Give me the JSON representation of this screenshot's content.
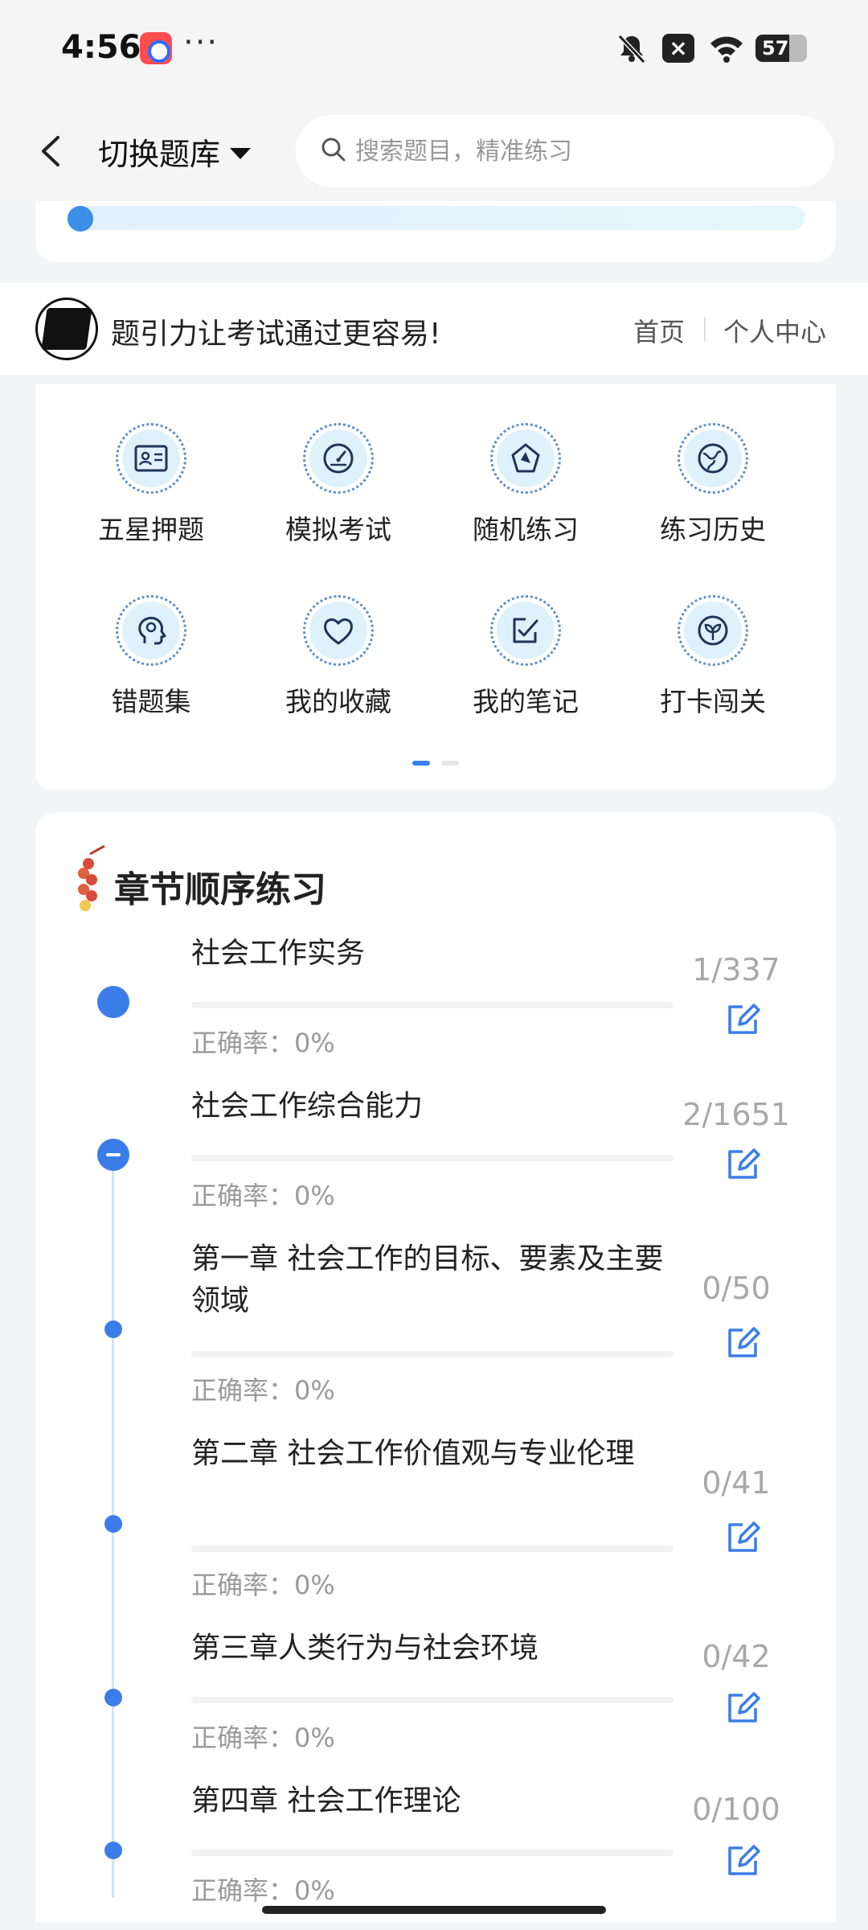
{
  "status_bar": {
    "time": "4:56",
    "more": "···",
    "close_glyph": "×",
    "battery": "57",
    "icons": [
      "app-icon",
      "bell-off-icon",
      "close-notification-icon",
      "wifi-icon",
      "battery-icon"
    ]
  },
  "header": {
    "switch_label": "切换题库",
    "search_placeholder": "搜索题目，精准练习"
  },
  "banner": {
    "slogan": "题引力让考试通过更容易!",
    "nav_home": "首页",
    "nav_user": "个人中心"
  },
  "grid": {
    "items": [
      {
        "label": "五星押题",
        "icon": "id-card-icon"
      },
      {
        "label": "模拟考试",
        "icon": "gauge-icon"
      },
      {
        "label": "随机练习",
        "icon": "compass-icon"
      },
      {
        "label": "练习历史",
        "icon": "globe-icon"
      },
      {
        "label": "错题集",
        "icon": "head-icon"
      },
      {
        "label": "我的收藏",
        "icon": "heart-icon"
      },
      {
        "label": "我的笔记",
        "icon": "note-check-icon"
      },
      {
        "label": "打卡闯关",
        "icon": "sprout-icon"
      }
    ],
    "page_count": 2,
    "active_page": 1
  },
  "chapters": {
    "title": "章节顺序练习",
    "items": [
      {
        "title": "社会工作实务",
        "accuracy": "正确率：0%",
        "count": "1/337"
      },
      {
        "title": "社会工作综合能力",
        "accuracy": "正确率：0%",
        "count": "2/1651"
      },
      {
        "title": "第一章 社会工作的目标、要素及主要领域",
        "accuracy": "正确率：0%",
        "count": "0/50"
      },
      {
        "title": "第二章 社会工作价值观与专业伦理",
        "accuracy": "正确率：0%",
        "count": "0/41"
      },
      {
        "title": "第三章人类行为与社会环境",
        "accuracy": "正确率：0%",
        "count": "0/42"
      },
      {
        "title": "第四章 社会工作理论",
        "accuracy": "正确率：0%",
        "count": "0/100"
      }
    ]
  },
  "colors": {
    "accent": "#3b7de8",
    "icon_bg": "#dff1fb",
    "background": "#f3f4f6"
  }
}
